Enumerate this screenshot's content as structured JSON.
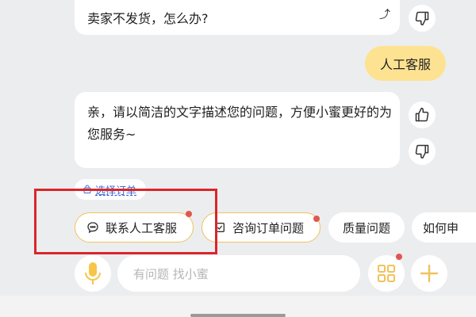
{
  "messages": {
    "bot_top": "卖家不发货，怎么办?",
    "user": "人工客服",
    "bot_reply": "亲，请以简洁的文字描述您的问题，方便小蜜更好的为您服务~"
  },
  "order_link": {
    "label": "选择订单"
  },
  "chips": [
    {
      "label": "联系人工客服"
    },
    {
      "label": "咨询订单问题"
    },
    {
      "label": "质量问题"
    },
    {
      "label": "如何申"
    }
  ],
  "input": {
    "placeholder": "有问题 找小蜜"
  },
  "colors": {
    "accent_yellow": "#f1c25a",
    "user_bubble": "#fde391",
    "badge_red": "#e0574f",
    "highlight_red": "#d9262c",
    "link_blue": "#3d6bd6"
  },
  "icons": [
    "thumbs-down-icon",
    "thumbs-up-icon",
    "microphone-icon",
    "grid-apps-icon",
    "plus-icon",
    "chat-bubble-icon",
    "order-icon",
    "bag-icon"
  ]
}
